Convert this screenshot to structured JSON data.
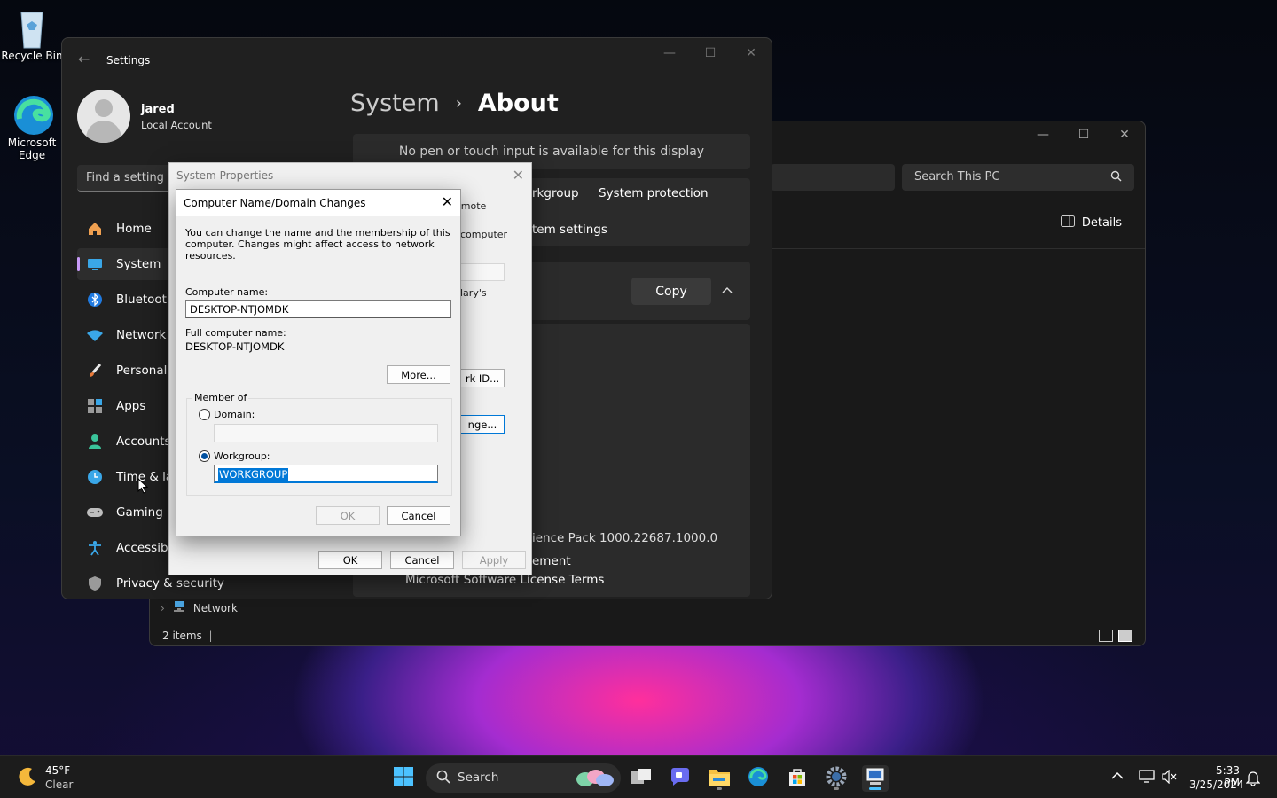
{
  "desktop": {
    "icons": [
      {
        "label": "Recycle Bin",
        "icon": "recycle-bin-icon"
      },
      {
        "label": "Microsoft Edge",
        "icon": "edge-icon"
      }
    ]
  },
  "explorer": {
    "search_placeholder": "Search This PC",
    "details_label": "Details",
    "nav_network": "Network",
    "status": "2 items"
  },
  "settings": {
    "title": "Settings",
    "user": {
      "name": "jared",
      "type": "Local Account"
    },
    "find_placeholder": "Find a setting",
    "nav": [
      {
        "label": "Home",
        "icon": "home-icon"
      },
      {
        "label": "System",
        "icon": "system-icon"
      },
      {
        "label": "Bluetooth",
        "icon": "bluetooth-icon"
      },
      {
        "label": "Network &",
        "icon": "wifi-icon"
      },
      {
        "label": "Personaliz",
        "icon": "brush-icon"
      },
      {
        "label": "Apps",
        "icon": "apps-icon"
      },
      {
        "label": "Accounts",
        "icon": "accounts-icon"
      },
      {
        "label": "Time & la",
        "icon": "clock-icon"
      },
      {
        "label": "Gaming",
        "icon": "gamepad-icon"
      },
      {
        "label": "Accessibil",
        "icon": "accessibility-icon"
      },
      {
        "label": "Privacy & security",
        "icon": "shield-icon"
      }
    ],
    "breadcrumb": {
      "parent": "System",
      "current": "About"
    },
    "pen_text": "No pen or touch input is available for this display",
    "links": {
      "workgroup": "rkgroup",
      "system_protection": "System protection",
      "advanced": "tem settings"
    },
    "copy_label": "Copy",
    "experience": "ience Pack 1000.22687.1000.0",
    "agreement": "ement",
    "license": "Microsoft Software License Terms"
  },
  "sysprops": {
    "title": "System Properties",
    "frag_remote": "emote",
    "frag_computer": "computer",
    "frag_ary": "lary's",
    "network_id": "rk ID...",
    "change": "nge...",
    "ok": "OK",
    "cancel": "Cancel",
    "apply": "Apply"
  },
  "cname_dialog": {
    "title": "Computer Name/Domain Changes",
    "description": "You can change the name and the membership of this computer. Changes might affect access to network resources.",
    "computer_name_label": "Computer name:",
    "computer_name_value": "DESKTOP-NTJOMDK",
    "full_name_label": "Full computer name:",
    "full_name_value": "DESKTOP-NTJOMDK",
    "more_button": "More...",
    "member_of": "Member of",
    "domain_label": "Domain:",
    "workgroup_label": "Workgroup:",
    "workgroup_value": "WORKGROUP",
    "ok": "OK",
    "cancel": "Cancel"
  },
  "taskbar": {
    "weather_temp": "45°F",
    "weather_cond": "Clear",
    "search_label": "Search",
    "time": "5:33 PM",
    "date": "3/25/2024"
  },
  "colors": {
    "accent": "#0078d7",
    "nav_indicator": "#c89bf7"
  }
}
